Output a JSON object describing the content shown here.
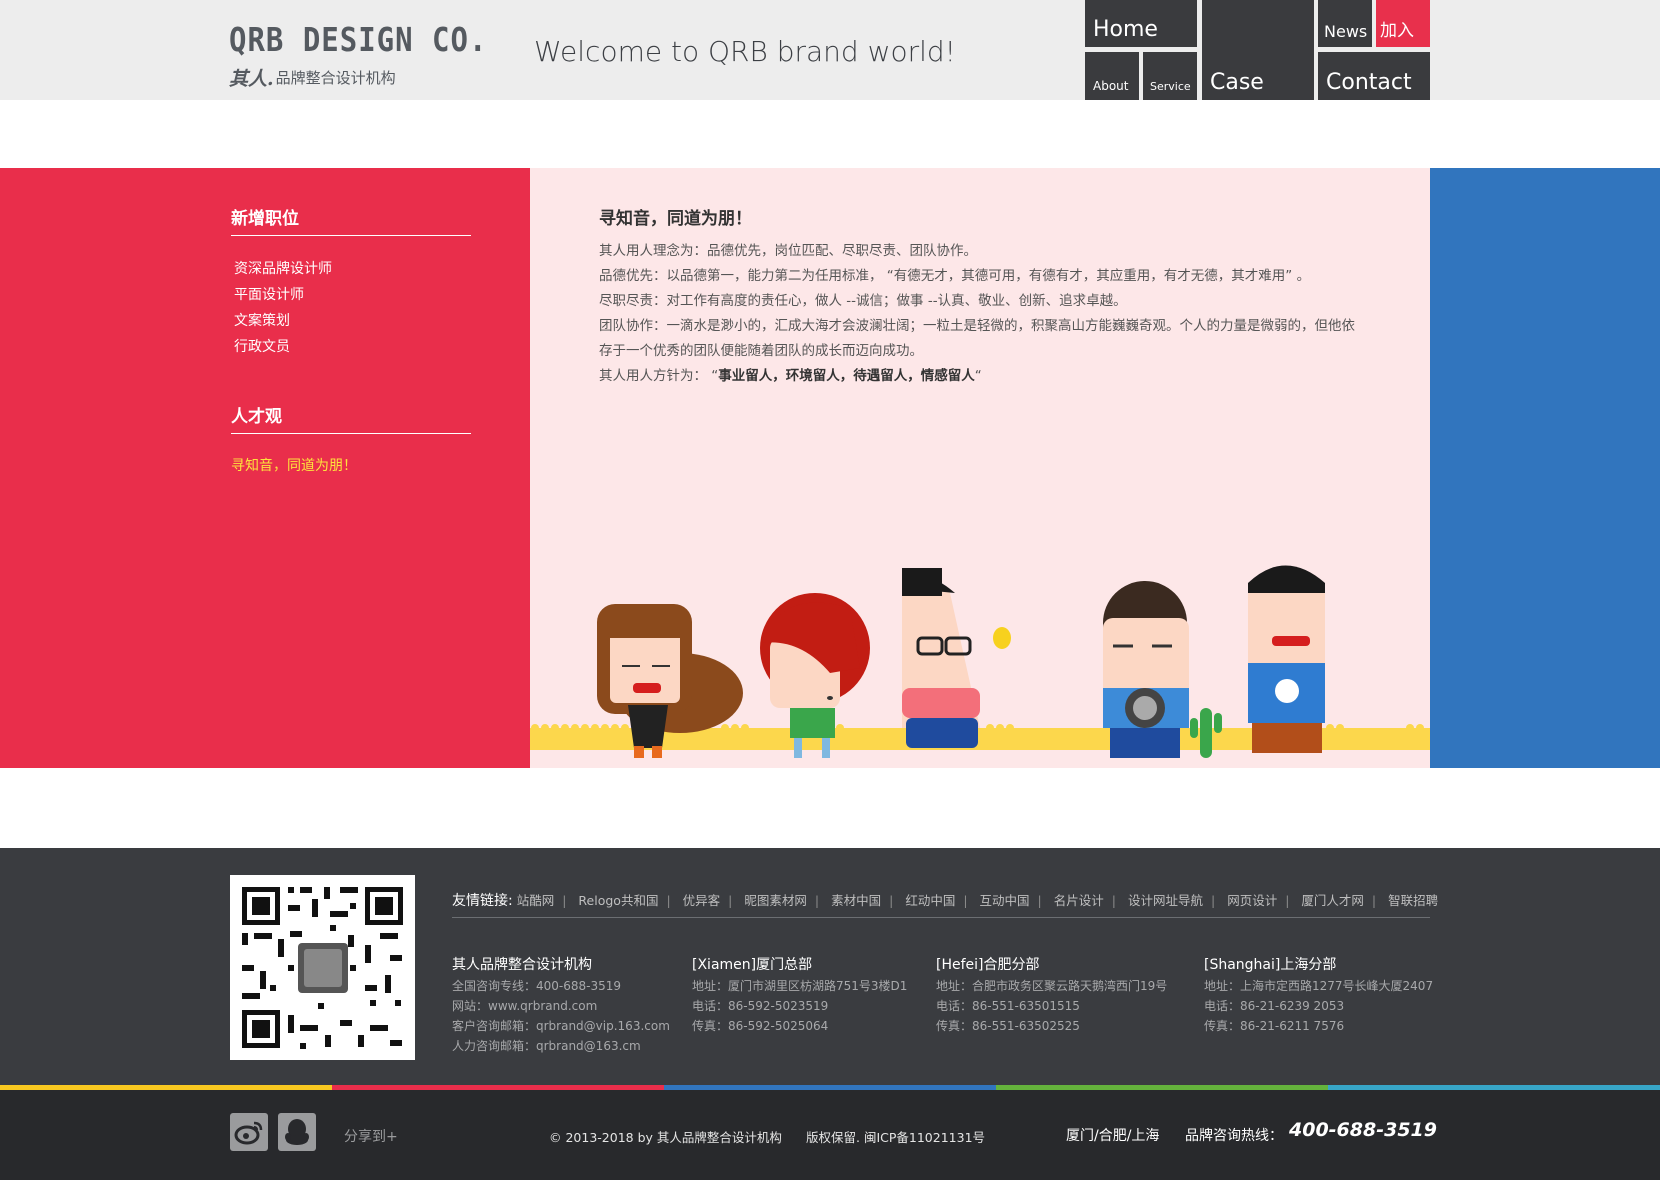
{
  "brand": {
    "logo_en": "QRB DESIGN CO.",
    "logo_mark": "其人.",
    "logo_cn": "品牌整合设计机构"
  },
  "header": {
    "welcome": "Welcome to QRB brand world!"
  },
  "nav": {
    "home": "Home",
    "about": "About",
    "service": "Service",
    "case": "Case",
    "news": "News",
    "join": "加入",
    "contact": "Contact"
  },
  "sidebar": {
    "jobs_title": "新增职位",
    "jobs": [
      "资深品牌设计师",
      "平面设计师",
      "文案策划",
      "行政文员"
    ],
    "talent_title": "人才观",
    "talent_text": "寻知音，同道为朋！"
  },
  "article": {
    "title": "寻知音，同道为朋！",
    "p1": "其人用人理念为：品德优先，岗位匹配、尽职尽责、团队协作。",
    "p2": "品德优先：以品德第一，能力第二为任用标准，  “有德无才，其德可用，有德有才，其应重用，有才无德，其才难用” 。",
    "p3": "尽职尽责：对工作有高度的责任心，做人 --诚信；做事 --认真、敬业、创新、追求卓越。",
    "p4": "团队协作：一滴水是渺小的，汇成大海才会波澜壮阔；一粒土是轻微的，积聚高山方能巍巍奇观。个人的力量是微弱的，但他依存于一个优秀的团队便能随着团队的成长而迈向成功。",
    "p5_prefix": "其人用人方针为：  “",
    "p5_bold": "事业留人，环境留人，待遇留人，情感留人",
    "p5_suffix": "“"
  },
  "footer": {
    "links_label": "友情链接:",
    "links": [
      "站酷网",
      "Relogo共和国",
      "优异客",
      "昵图素材网",
      "素材中国",
      "红动中国",
      "互动中国",
      "名片设计",
      "设计网址导航",
      "网页设计",
      "厦门人才网",
      "智联招聘"
    ],
    "company": {
      "name": "其人品牌整合设计机构",
      "hotline": "全国咨询专线：400-688-3519",
      "site": "网站：www.qrbrand.com",
      "cs_mail": "客户咨询邮箱：qrbrand@vip.163.com",
      "hr_mail": "人力咨询邮箱：qrbrand@163.cm"
    },
    "xiamen": {
      "name": "[Xiamen]厦门总部",
      "addr": "地址：厦门市湖里区枋湖路751号3楼D1",
      "tel": "电话：86-592-5023519",
      "fax": "传真：86-592-5025064"
    },
    "hefei": {
      "name": "[Hefei]合肥分部",
      "addr": "地址：合肥市政务区聚云路天鹅湾西门19号",
      "tel": "电话：86-551-63501515",
      "fax": "传真：86-551-63502525"
    },
    "shanghai": {
      "name": "[Shanghai]上海分部",
      "addr": "地址：上海市定西路1277号长峰大厦2407",
      "tel": "电话：86-21-6239 2053",
      "fax": "传真：86-21-6211 7576"
    }
  },
  "bottom": {
    "share": "分享到+",
    "copyright": "© 2013-2018 by 其人品牌整合设计机构",
    "icp": "版权保留. 闽ICP备11021131号",
    "cities": "厦门/合肥/上海",
    "hotline_label": "品牌咨询热线：",
    "hotline_number": "400-688-3519"
  },
  "colors": {
    "red": "#e92e4b",
    "pink": "#fde7e8",
    "blue": "#3175be",
    "tile": "#3a3b3e",
    "footer": "#3a3c40",
    "bottom": "#28292c",
    "stripe": [
      "#f8c820",
      "#e92e4b",
      "#3175be",
      "#64b33c",
      "#37a6c8"
    ]
  },
  "icons": [
    "weibo-icon",
    "qq-icon",
    "qr-code"
  ]
}
